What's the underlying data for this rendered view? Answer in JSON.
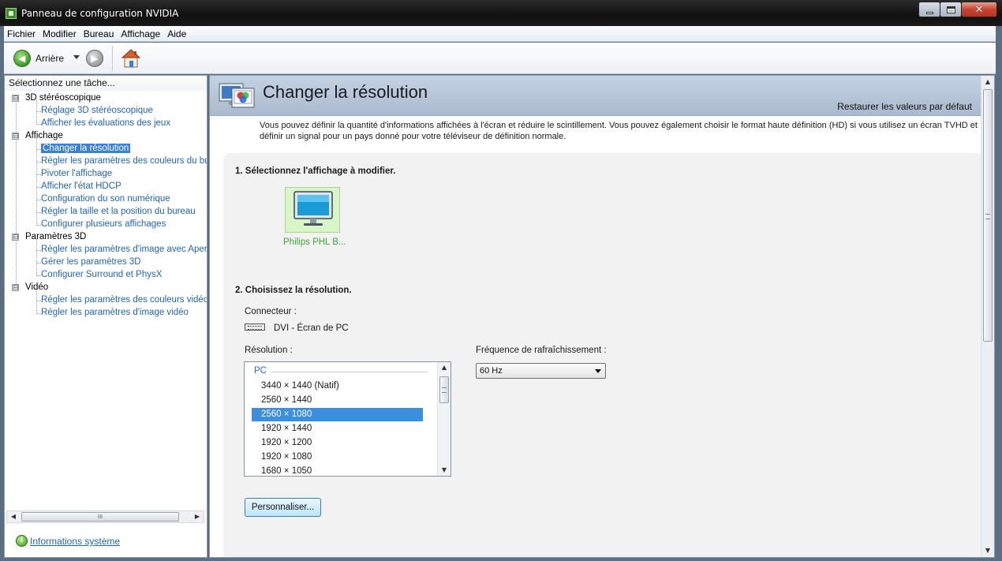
{
  "window": {
    "title": "Panneau de configuration NVIDIA"
  },
  "menu": [
    "Fichier",
    "Modifier",
    "Bureau",
    "Affichage",
    "Aide"
  ],
  "toolbar": {
    "back_label": "Arrière",
    "back_icon": "back-arrow-icon",
    "forward_icon": "forward-arrow-icon",
    "home_icon": "home-icon"
  },
  "sidebar": {
    "header": "Sélectionnez une tâche...",
    "groups": [
      {
        "label": "3D stéréoscopique",
        "expander": "⊟",
        "items": [
          "Réglage 3D stéréoscopique",
          "Afficher les évaluations des jeux"
        ]
      },
      {
        "label": "Affichage",
        "expander": "⊟",
        "items": [
          "Changer la résolution",
          "Régler les paramètres des couleurs du bure",
          "Pivoter l'affichage",
          "Afficher l'état HDCP",
          "Configuration du son numérique",
          "Régler la taille et la position du bureau",
          "Configurer plusieurs affichages"
        ]
      },
      {
        "label": "Paramètres 3D",
        "expander": "⊟",
        "items": [
          "Régler les paramètres d'image avec Aperçu",
          "Gérer les paramètres 3D",
          "Configurer Surround et PhysX"
        ]
      },
      {
        "label": "Vidéo",
        "expander": "⊟",
        "items": [
          "Régler les paramètres des couleurs vidéo",
          "Régler les paramètres d'image vidéo"
        ]
      }
    ],
    "selected_item": "Changer la résolution",
    "scroll_grip": "III",
    "system_info_link": "Informations système"
  },
  "page": {
    "title": "Changer la résolution",
    "restore_defaults": "Restaurer les valeurs par défaut",
    "description": "Vous pouvez définir la quantité d'informations affichées à l'écran et réduire le scintillement. Vous pouvez également choisir le format haute définition (HD) si vous utilisez un écran TVHD et définir un signal pour un pays donné pour votre téléviseur de définition normale.",
    "step1": "1. Sélectionnez l'affichage à modifier.",
    "display_name": "Philips PHL B...",
    "step2": "2. Choisissez la résolution.",
    "connector_label": "Connecteur :",
    "connector_value": "DVI - Écran de PC",
    "resolution_label": "Résolution :",
    "resolution_group": "PC",
    "resolutions": [
      "3440 × 1440 (Natif)",
      "2560 × 1440",
      "2560 × 1080",
      "1920 × 1440",
      "1920 × 1200",
      "1920 × 1080",
      "1680 × 1050"
    ],
    "selected_resolution": "2560 × 1080",
    "refresh_label": "Fréquence de rafraîchissement :",
    "refresh_value": "60 Hz",
    "customize_button": "Personnaliser..."
  },
  "colors": {
    "link": "#1f64c8",
    "selection": "#3a80d7",
    "display_name": "#3ea33a",
    "banner": "#b6c5d8"
  }
}
